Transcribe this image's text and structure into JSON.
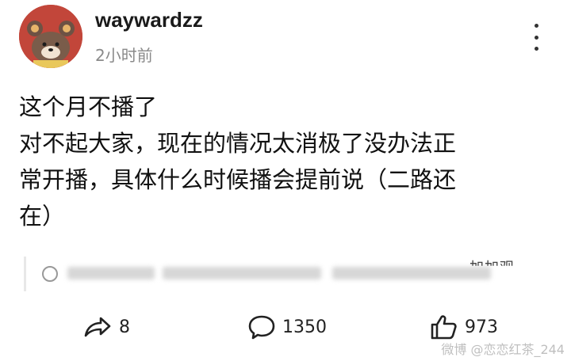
{
  "post": {
    "username": "waywardzz",
    "timestamp": "2小时前",
    "lines": [
      "这个月不播了",
      "对不起大家，现在的情况太消极了没办法正",
      "常开播，具体什么时候播会提前说（二路还",
      "在）"
    ]
  },
  "repost_preview": {
    "visible_text": "加加观"
  },
  "actions": {
    "share_count": "8",
    "comment_count": "1350",
    "like_count": "973"
  },
  "watermark": {
    "text": "微博 @恋恋红茶_244"
  },
  "colors": {
    "avatar_bg": "#c2463a",
    "muted_text": "#8a8a8a",
    "repost_border": "#e8e8e8"
  }
}
